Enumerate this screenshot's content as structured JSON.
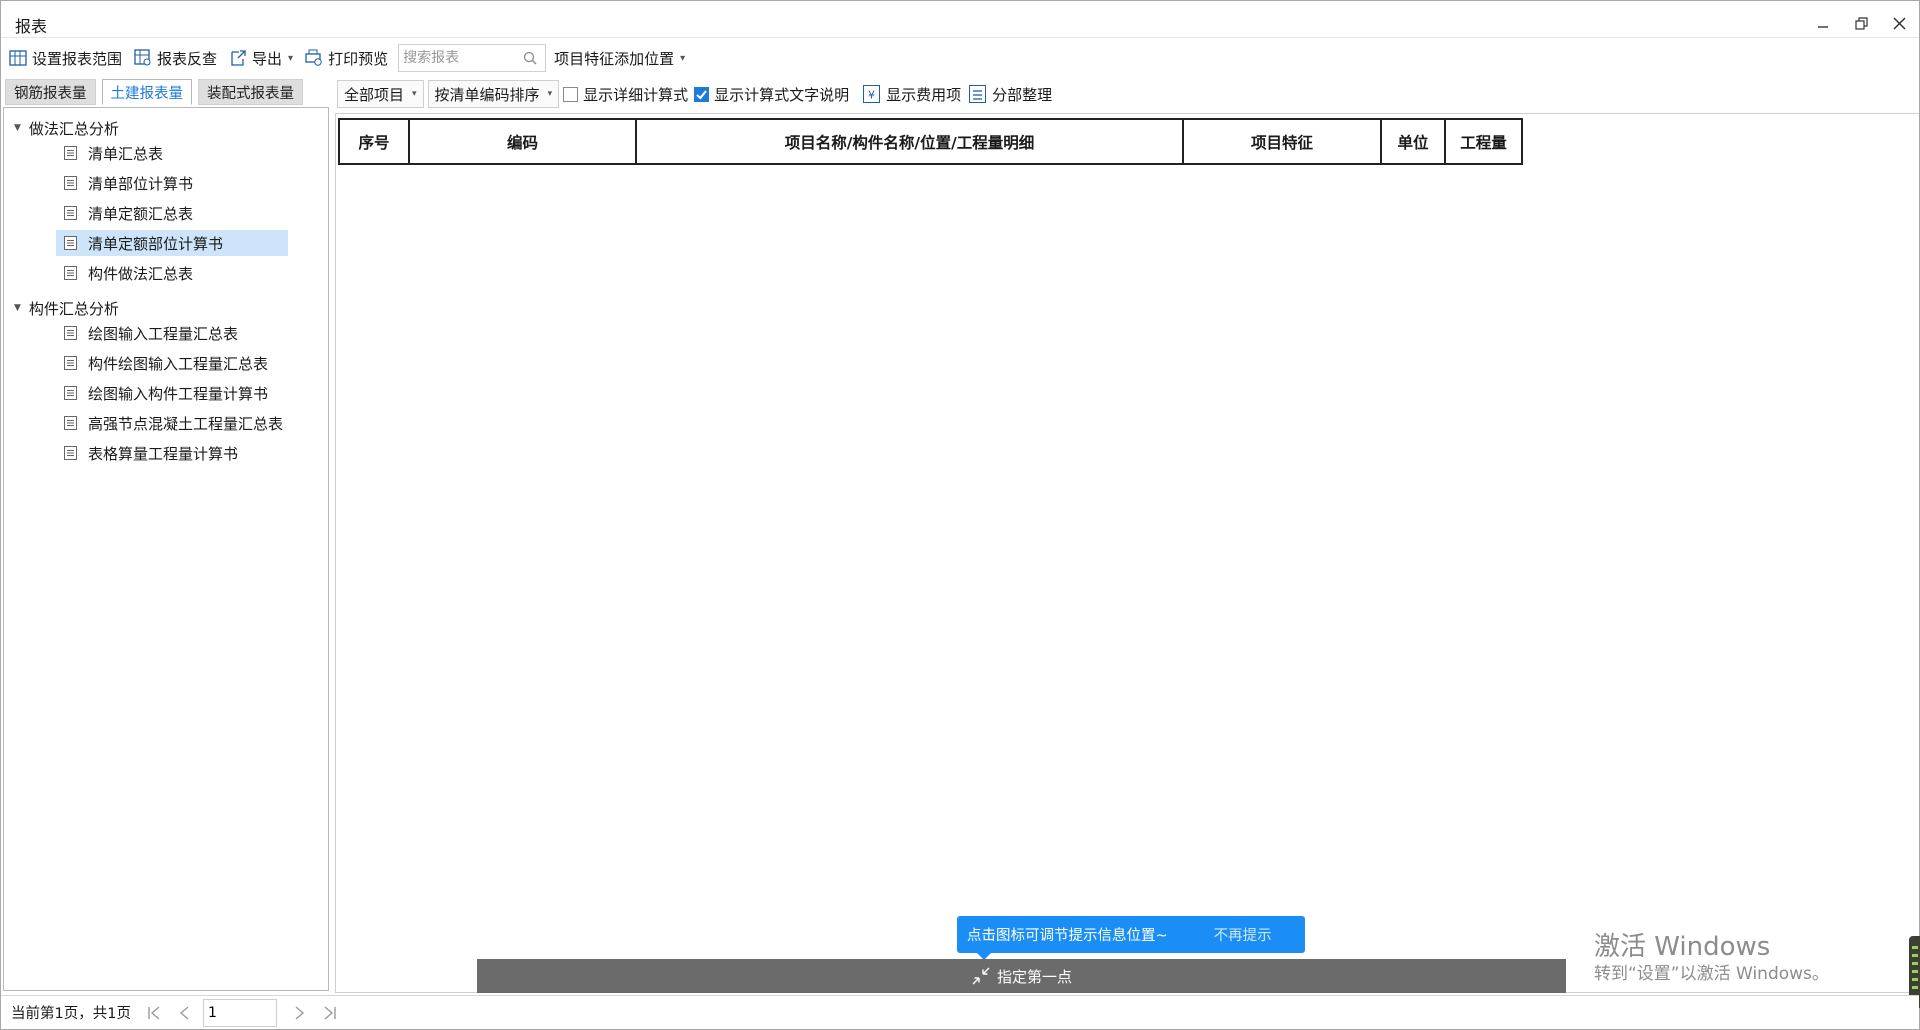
{
  "window": {
    "title": "报表"
  },
  "toolbar": {
    "set_range": "设置报表范围",
    "reverse_check": "报表反查",
    "export": "导出",
    "print_preview": "打印预览",
    "search_placeholder": "搜索报表",
    "feature_position": "项目特征添加位置"
  },
  "left_tabs": [
    "钢筋报表量",
    "土建报表量",
    "装配式报表量"
  ],
  "tree": {
    "groups": [
      {
        "label": "做法汇总分析",
        "items": [
          "清单汇总表",
          "清单部位计算书",
          "清单定额汇总表",
          "清单定额部位计算书",
          "构件做法汇总表"
        ]
      },
      {
        "label": "构件汇总分析",
        "items": [
          "绘图输入工程量汇总表",
          "构件绘图输入工程量汇总表",
          "绘图输入构件工程量计算书",
          "高强节点混凝土工程量汇总表",
          "表格算量工程量计算书"
        ]
      }
    ],
    "selected": "清单定额部位计算书"
  },
  "filter": {
    "scope": "全部项目",
    "sort": "按清单编码排序",
    "show_detail_formula": "显示详细计算式",
    "show_detail_formula_checked": false,
    "show_formula_text": "显示计算式文字说明",
    "show_formula_text_checked": true,
    "show_fee_items": "显示费用项",
    "section_organize": "分部整理"
  },
  "table": {
    "headers": [
      "序号",
      "编码",
      "项目名称/构件名称/位置/工程量明细",
      "项目特征",
      "单位",
      "工程量"
    ]
  },
  "tip": {
    "text": "点击图标可调节提示信息位置~",
    "dismiss": "不再提示"
  },
  "pickbar": {
    "label": "指定第一点"
  },
  "watermark": {
    "line1": "激活 Windows",
    "line2": "转到“设置”以激活 Windows。"
  },
  "status": {
    "page_text": "当前第1页，共1页",
    "page_value": "1"
  }
}
